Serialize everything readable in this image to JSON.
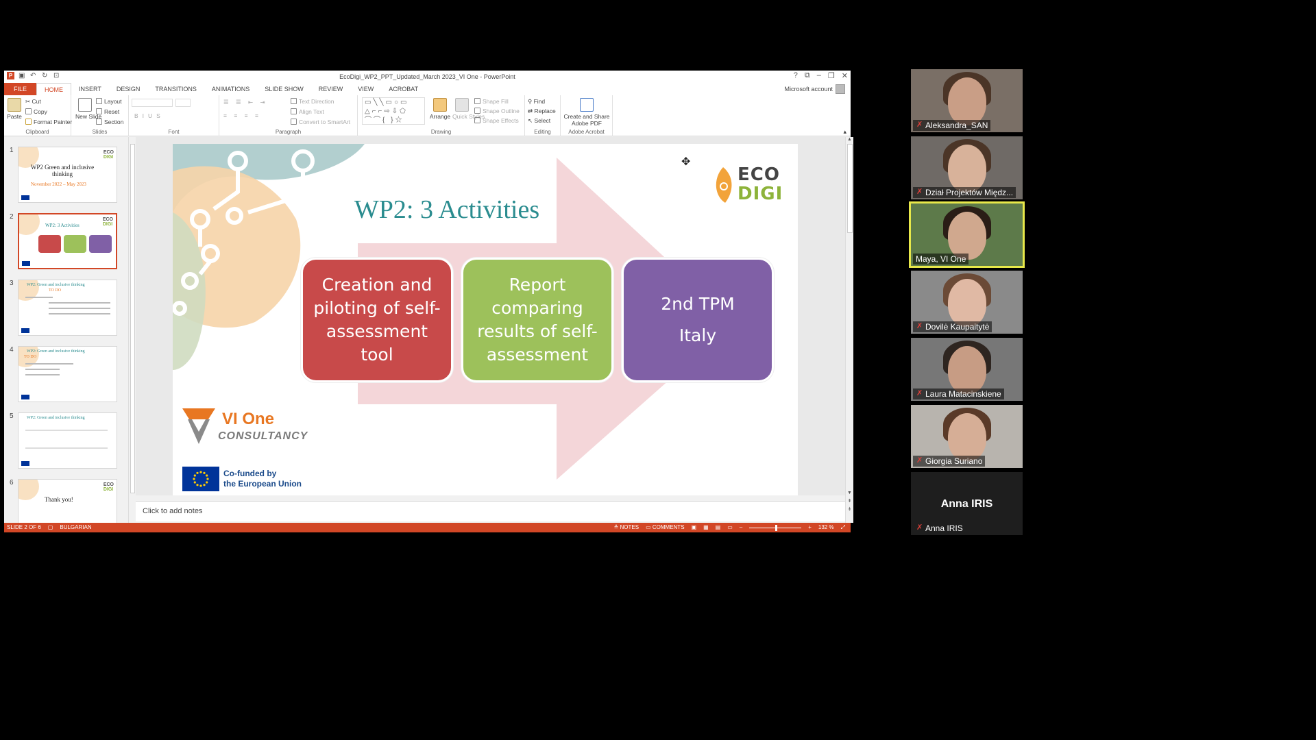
{
  "ppt": {
    "window_title": "EcoDigi_WP2_PPT_Updated_March 2023_VI One - PowerPoint",
    "tabs": [
      "FILE",
      "HOME",
      "INSERT",
      "DESIGN",
      "TRANSITIONS",
      "ANIMATIONS",
      "SLIDE SHOW",
      "REVIEW",
      "VIEW",
      "ACROBAT"
    ],
    "active_tab": "HOME",
    "account": "Microsoft account",
    "ribbon": {
      "clipboard": {
        "paste": "Paste",
        "cut": "Cut",
        "copy": "Copy",
        "format_painter": "Format Painter",
        "label": "Clipboard"
      },
      "slides": {
        "new_slide": "New Slide",
        "layout": "Layout",
        "reset": "Reset",
        "section": "Section",
        "label": "Slides"
      },
      "font": {
        "label": "Font"
      },
      "paragraph": {
        "text_direction": "Text Direction",
        "align_text": "Align Text",
        "convert": "Convert to SmartArt",
        "label": "Paragraph"
      },
      "drawing": {
        "arrange": "Arrange",
        "quick_styles": "Quick Styles",
        "shape_fill": "Shape Fill",
        "shape_outline": "Shape Outline",
        "shape_effects": "Shape Effects",
        "label": "Drawing"
      },
      "editing": {
        "find": "Find",
        "replace": "Replace",
        "select": "Select",
        "label": "Editing"
      },
      "acrobat": {
        "create": "Create and Share Adobe PDF",
        "label": "Adobe Acrobat"
      }
    },
    "thumbnails": [
      {
        "num": "1",
        "title": "WP2 Green and inclusive thinking",
        "sub": "November 2022 – May 2023"
      },
      {
        "num": "2",
        "title": "WP2: 3 Activities",
        "sub": ""
      },
      {
        "num": "3",
        "title": "WP2: Green and inclusive thinking",
        "sub": "TO DO"
      },
      {
        "num": "4",
        "title": "WP2: Green and inclusive thinking",
        "sub": "TO DO"
      },
      {
        "num": "5",
        "title": "WP2: Green and inclusive thinking",
        "sub": ""
      },
      {
        "num": "6",
        "title": "Thank you!",
        "sub": ""
      }
    ],
    "slide": {
      "title": "WP2: 3 Activities",
      "boxes": [
        {
          "lines": [
            "Creation and",
            "piloting of self-",
            "assessment",
            "tool"
          ],
          "color": "#c84a4a"
        },
        {
          "lines": [
            "Report",
            "comparing",
            "results of self-",
            "assessment"
          ],
          "color": "#9dc15b"
        },
        {
          "lines": [
            "2nd TPM",
            "Italy"
          ],
          "color": "#8060a6"
        }
      ],
      "logo_eco": "ECO",
      "logo_digi": "DIGI",
      "vione_name": "VI One",
      "vione_sub": "CONSULTANCY",
      "eu_line1": "Co-funded by",
      "eu_line2": "the European Union"
    },
    "notes_placeholder": "Click to add notes",
    "status": {
      "slide_of": "SLIDE 2 OF 6",
      "language": "BULGARIAN",
      "notes": "NOTES",
      "comments": "COMMENTS",
      "zoom": "132 %"
    }
  },
  "participants": [
    {
      "name": "Aleksandra_SAN",
      "muted": true,
      "active": false
    },
    {
      "name": "Dział Projektów Międz...",
      "muted": true,
      "active": false
    },
    {
      "name": "Maya, VI One",
      "muted": false,
      "active": true
    },
    {
      "name": "Dovilė Kaupaitytė",
      "muted": true,
      "active": false
    },
    {
      "name": "Laura Matacinskiene",
      "muted": true,
      "active": false
    },
    {
      "name": "Giorgia Suriano",
      "muted": true,
      "active": false
    },
    {
      "name": "Anna IRIS",
      "muted": true,
      "active": false,
      "video_off_label": "Anna IRIS"
    }
  ],
  "colors": {
    "accent": "#d24726",
    "title_teal": "#2a8c8f",
    "active_speaker": "#e8e84a"
  }
}
